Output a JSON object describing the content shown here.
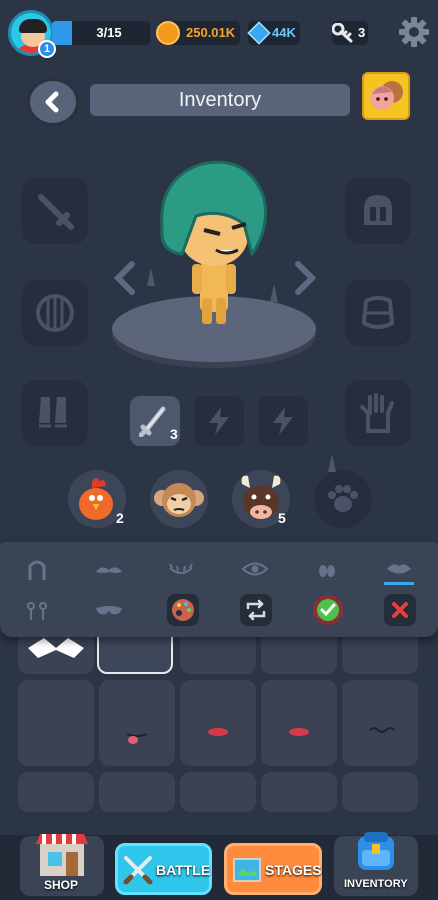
{
  "player": {
    "level": "1",
    "xp_text": "3/15",
    "xp_fraction": 0.2
  },
  "currency": {
    "coins": "250.01K",
    "gems": "44K",
    "keys": "3"
  },
  "header": {
    "title": "Inventory"
  },
  "items": {
    "weapon_count": "3"
  },
  "pets": [
    {
      "name": "chicken",
      "count": "2"
    },
    {
      "name": "monkey",
      "count": ""
    },
    {
      "name": "bull",
      "count": "5"
    }
  ],
  "nav": {
    "shop_label": "SHOP",
    "battle_label": "BATTLE",
    "stages_label": "STAGES",
    "inventory_label": "INVENTORY"
  },
  "colors": {
    "accent_blue": "#2f9ae8",
    "coin": "#f39b1f",
    "battle": "#2ec6ea",
    "stages": "#ff8b3d",
    "confirm": "#4cc24c",
    "cancel": "#e84040"
  }
}
